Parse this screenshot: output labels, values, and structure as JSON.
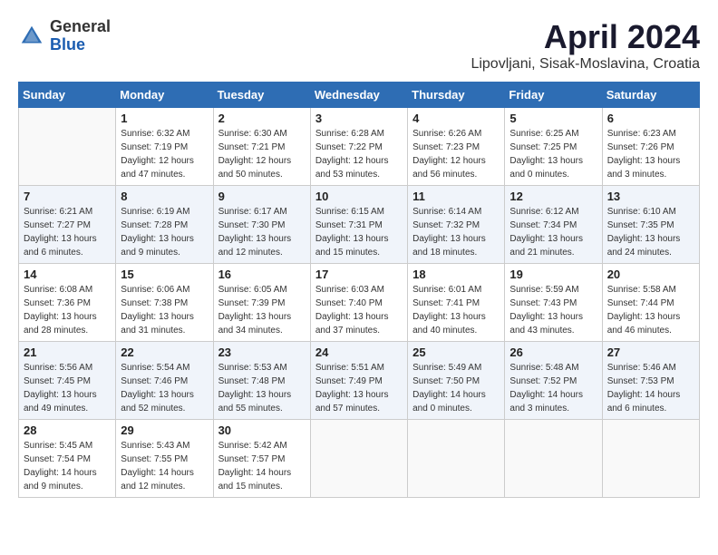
{
  "header": {
    "logo_general": "General",
    "logo_blue": "Blue",
    "month_title": "April 2024",
    "location": "Lipovljani, Sisak-Moslavina, Croatia"
  },
  "weekdays": [
    "Sunday",
    "Monday",
    "Tuesday",
    "Wednesday",
    "Thursday",
    "Friday",
    "Saturday"
  ],
  "weeks": [
    [
      {
        "day": "",
        "sunrise": "",
        "sunset": "",
        "daylight": ""
      },
      {
        "day": "1",
        "sunrise": "Sunrise: 6:32 AM",
        "sunset": "Sunset: 7:19 PM",
        "daylight": "Daylight: 12 hours and 47 minutes."
      },
      {
        "day": "2",
        "sunrise": "Sunrise: 6:30 AM",
        "sunset": "Sunset: 7:21 PM",
        "daylight": "Daylight: 12 hours and 50 minutes."
      },
      {
        "day": "3",
        "sunrise": "Sunrise: 6:28 AM",
        "sunset": "Sunset: 7:22 PM",
        "daylight": "Daylight: 12 hours and 53 minutes."
      },
      {
        "day": "4",
        "sunrise": "Sunrise: 6:26 AM",
        "sunset": "Sunset: 7:23 PM",
        "daylight": "Daylight: 12 hours and 56 minutes."
      },
      {
        "day": "5",
        "sunrise": "Sunrise: 6:25 AM",
        "sunset": "Sunset: 7:25 PM",
        "daylight": "Daylight: 13 hours and 0 minutes."
      },
      {
        "day": "6",
        "sunrise": "Sunrise: 6:23 AM",
        "sunset": "Sunset: 7:26 PM",
        "daylight": "Daylight: 13 hours and 3 minutes."
      }
    ],
    [
      {
        "day": "7",
        "sunrise": "Sunrise: 6:21 AM",
        "sunset": "Sunset: 7:27 PM",
        "daylight": "Daylight: 13 hours and 6 minutes."
      },
      {
        "day": "8",
        "sunrise": "Sunrise: 6:19 AM",
        "sunset": "Sunset: 7:28 PM",
        "daylight": "Daylight: 13 hours and 9 minutes."
      },
      {
        "day": "9",
        "sunrise": "Sunrise: 6:17 AM",
        "sunset": "Sunset: 7:30 PM",
        "daylight": "Daylight: 13 hours and 12 minutes."
      },
      {
        "day": "10",
        "sunrise": "Sunrise: 6:15 AM",
        "sunset": "Sunset: 7:31 PM",
        "daylight": "Daylight: 13 hours and 15 minutes."
      },
      {
        "day": "11",
        "sunrise": "Sunrise: 6:14 AM",
        "sunset": "Sunset: 7:32 PM",
        "daylight": "Daylight: 13 hours and 18 minutes."
      },
      {
        "day": "12",
        "sunrise": "Sunrise: 6:12 AM",
        "sunset": "Sunset: 7:34 PM",
        "daylight": "Daylight: 13 hours and 21 minutes."
      },
      {
        "day": "13",
        "sunrise": "Sunrise: 6:10 AM",
        "sunset": "Sunset: 7:35 PM",
        "daylight": "Daylight: 13 hours and 24 minutes."
      }
    ],
    [
      {
        "day": "14",
        "sunrise": "Sunrise: 6:08 AM",
        "sunset": "Sunset: 7:36 PM",
        "daylight": "Daylight: 13 hours and 28 minutes."
      },
      {
        "day": "15",
        "sunrise": "Sunrise: 6:06 AM",
        "sunset": "Sunset: 7:38 PM",
        "daylight": "Daylight: 13 hours and 31 minutes."
      },
      {
        "day": "16",
        "sunrise": "Sunrise: 6:05 AM",
        "sunset": "Sunset: 7:39 PM",
        "daylight": "Daylight: 13 hours and 34 minutes."
      },
      {
        "day": "17",
        "sunrise": "Sunrise: 6:03 AM",
        "sunset": "Sunset: 7:40 PM",
        "daylight": "Daylight: 13 hours and 37 minutes."
      },
      {
        "day": "18",
        "sunrise": "Sunrise: 6:01 AM",
        "sunset": "Sunset: 7:41 PM",
        "daylight": "Daylight: 13 hours and 40 minutes."
      },
      {
        "day": "19",
        "sunrise": "Sunrise: 5:59 AM",
        "sunset": "Sunset: 7:43 PM",
        "daylight": "Daylight: 13 hours and 43 minutes."
      },
      {
        "day": "20",
        "sunrise": "Sunrise: 5:58 AM",
        "sunset": "Sunset: 7:44 PM",
        "daylight": "Daylight: 13 hours and 46 minutes."
      }
    ],
    [
      {
        "day": "21",
        "sunrise": "Sunrise: 5:56 AM",
        "sunset": "Sunset: 7:45 PM",
        "daylight": "Daylight: 13 hours and 49 minutes."
      },
      {
        "day": "22",
        "sunrise": "Sunrise: 5:54 AM",
        "sunset": "Sunset: 7:46 PM",
        "daylight": "Daylight: 13 hours and 52 minutes."
      },
      {
        "day": "23",
        "sunrise": "Sunrise: 5:53 AM",
        "sunset": "Sunset: 7:48 PM",
        "daylight": "Daylight: 13 hours and 55 minutes."
      },
      {
        "day": "24",
        "sunrise": "Sunrise: 5:51 AM",
        "sunset": "Sunset: 7:49 PM",
        "daylight": "Daylight: 13 hours and 57 minutes."
      },
      {
        "day": "25",
        "sunrise": "Sunrise: 5:49 AM",
        "sunset": "Sunset: 7:50 PM",
        "daylight": "Daylight: 14 hours and 0 minutes."
      },
      {
        "day": "26",
        "sunrise": "Sunrise: 5:48 AM",
        "sunset": "Sunset: 7:52 PM",
        "daylight": "Daylight: 14 hours and 3 minutes."
      },
      {
        "day": "27",
        "sunrise": "Sunrise: 5:46 AM",
        "sunset": "Sunset: 7:53 PM",
        "daylight": "Daylight: 14 hours and 6 minutes."
      }
    ],
    [
      {
        "day": "28",
        "sunrise": "Sunrise: 5:45 AM",
        "sunset": "Sunset: 7:54 PM",
        "daylight": "Daylight: 14 hours and 9 minutes."
      },
      {
        "day": "29",
        "sunrise": "Sunrise: 5:43 AM",
        "sunset": "Sunset: 7:55 PM",
        "daylight": "Daylight: 14 hours and 12 minutes."
      },
      {
        "day": "30",
        "sunrise": "Sunrise: 5:42 AM",
        "sunset": "Sunset: 7:57 PM",
        "daylight": "Daylight: 14 hours and 15 minutes."
      },
      {
        "day": "",
        "sunrise": "",
        "sunset": "",
        "daylight": ""
      },
      {
        "day": "",
        "sunrise": "",
        "sunset": "",
        "daylight": ""
      },
      {
        "day": "",
        "sunrise": "",
        "sunset": "",
        "daylight": ""
      },
      {
        "day": "",
        "sunrise": "",
        "sunset": "",
        "daylight": ""
      }
    ]
  ]
}
